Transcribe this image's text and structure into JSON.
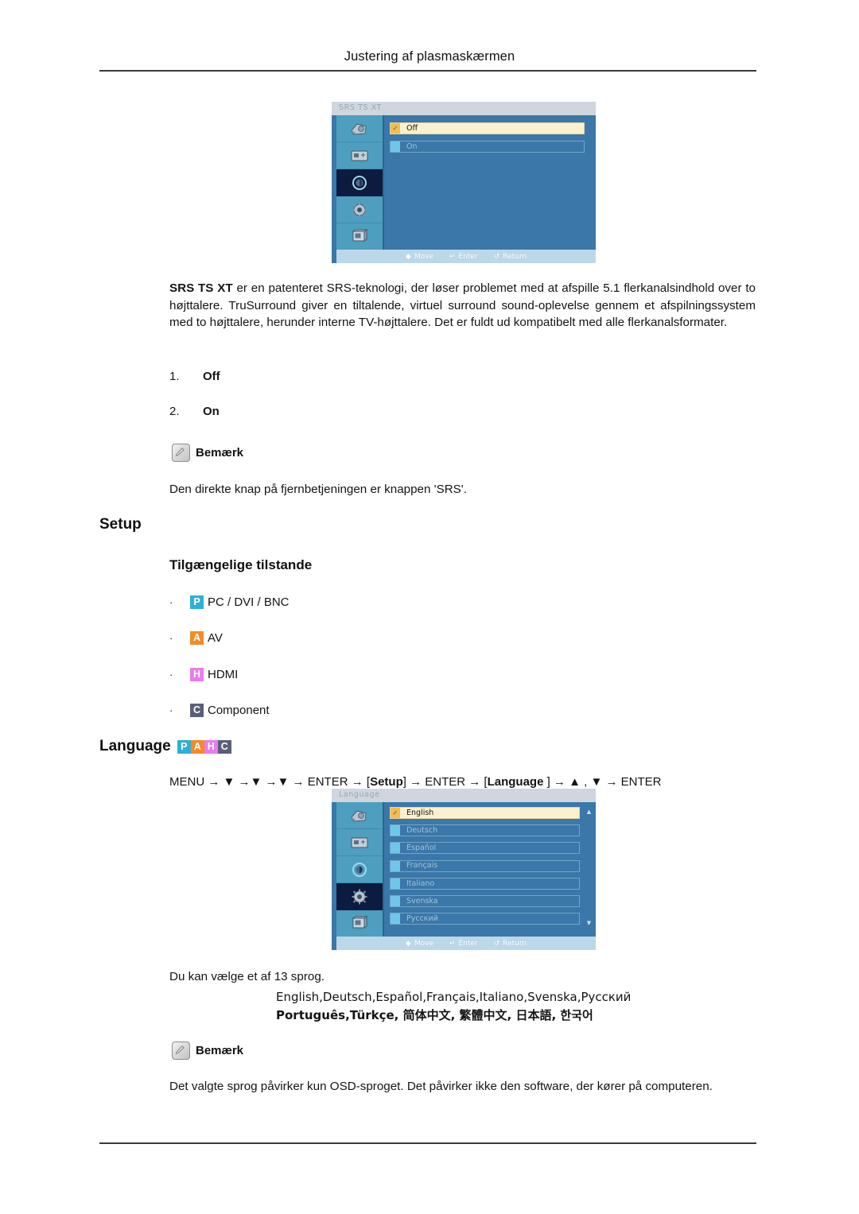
{
  "header": {
    "title": "Justering af plasmaskærmen"
  },
  "srs_osd": {
    "title": "SRS TS XT",
    "rows": [
      {
        "label": "Off",
        "selected": true
      },
      {
        "label": "On",
        "selected": false
      }
    ],
    "footer": [
      {
        "glyph": "◆",
        "label": "Move"
      },
      {
        "glyph": "↵",
        "label": "Enter"
      },
      {
        "glyph": "↺",
        "label": "Return"
      }
    ],
    "active_icon_index": 2
  },
  "srs_paragraph": {
    "lead": "SRS TS XT",
    "rest": " er en patenteret SRS-teknologi, der løser problemet med at afspille 5.1 flerkanalsindhold over to højttalere. TruSurround giver en tiltalende, virtuel surround sound-oplevelse gennem et afspilningssystem med to højttalere, herunder interne TV-højttalere. Det er fuldt ud kompatibelt med alle flerkanalsformater."
  },
  "srs_options": [
    {
      "number": "1.",
      "label": "Off"
    },
    {
      "number": "2.",
      "label": "On"
    }
  ],
  "note1": {
    "label": "Bemærk",
    "text": "Den direkte knap på fjernbetjeningen er knappen 'SRS'."
  },
  "setup": {
    "heading": "Setup",
    "subheading": "Tilgængelige tilstande",
    "modes": [
      {
        "badge": "P",
        "color": "#2eafd7",
        "label": "PC / DVI / BNC"
      },
      {
        "badge": "A",
        "color": "#f48a28",
        "label": "AV"
      },
      {
        "badge": "H",
        "color": "#e87ced",
        "label": "HDMI"
      },
      {
        "badge": "C",
        "color": "#5a5f78",
        "label": "Component"
      }
    ]
  },
  "language_section": {
    "heading": "Language",
    "badges": [
      {
        "badge": "P",
        "color": "#2eafd7"
      },
      {
        "badge": "A",
        "color": "#f48a28"
      },
      {
        "badge": "H",
        "color": "#e87ced"
      },
      {
        "badge": "C",
        "color": "#5a5f78"
      }
    ],
    "menu_path_parts": [
      {
        "text": "MENU → ▼ →▼ →▼ → ENTER → [",
        "bold": false
      },
      {
        "text": "Setup",
        "bold": true
      },
      {
        "text": "] → ENTER → [",
        "bold": false
      },
      {
        "text": "Language",
        "bold": true
      },
      {
        "text": " ] → ▲ , ▼ → ENTER",
        "bold": false
      }
    ],
    "menu_path_plain": "MENU → ▼ →▼ →▼ → ENTER → [Setup] → ENTER → [Language ] → ▲ , ▼ → ENTER",
    "intro": "Du kan vælge et af 13 sprog.",
    "languages_line1": "English,Deutsch,Español,Français,Italiano,Svenska,Русский",
    "languages_line2": "Português,Türkçe, 简体中文,  繁體中文, 日本語, 한국어"
  },
  "language_osd": {
    "title": "Language",
    "rows": [
      {
        "label": "English",
        "selected": true
      },
      {
        "label": "Deutsch",
        "selected": false
      },
      {
        "label": "Español",
        "selected": false
      },
      {
        "label": "Français",
        "selected": false
      },
      {
        "label": "Italiano",
        "selected": false
      },
      {
        "label": "Svenska",
        "selected": false
      },
      {
        "label": "Русский",
        "selected": false
      }
    ],
    "footer": [
      {
        "glyph": "◆",
        "label": "Move"
      },
      {
        "glyph": "↵",
        "label": "Enter"
      },
      {
        "glyph": "↺",
        "label": "Return"
      }
    ],
    "scroll_up": "▲",
    "scroll_down": "▼",
    "active_icon_index": 3
  },
  "note2": {
    "label": "Bemærk",
    "text": "Det valgte sprog påvirker kun OSD-sproget. Det påvirker ikke den software, der kører på computeren."
  }
}
